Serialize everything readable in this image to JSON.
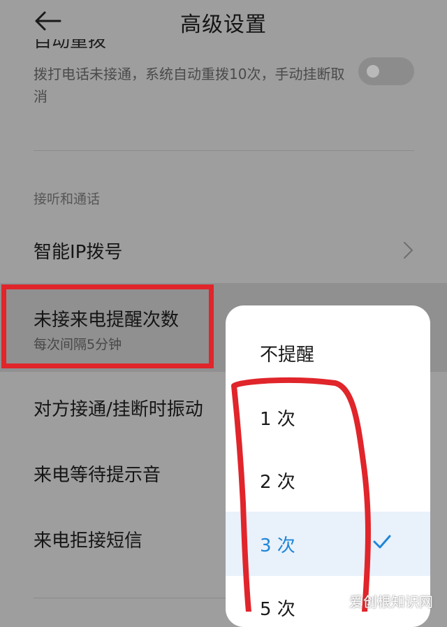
{
  "header": {
    "title": "高级设置",
    "back_icon": "arrow-left-icon"
  },
  "auto_redial": {
    "title": "自动重拨",
    "description": "拨打电话未接通，系统自动重拨10次，手动挂断取消",
    "toggle_on": false
  },
  "section": {
    "title": "接听和通话"
  },
  "rows": {
    "ip_dial": "智能IP拨号",
    "missed_reminder": "未接来电提醒次数",
    "missed_reminder_sub": "每次间隔5分钟",
    "vibrate": "对方接通/挂断时振动",
    "waiting_tone": "来电等待提示音",
    "reject_sms": "来电拒接短信"
  },
  "popup": {
    "options": [
      "不提醒",
      "1 次",
      "2 次",
      "3 次",
      "5 次"
    ],
    "selected": "3 次"
  },
  "colors": {
    "accent": "#1f86d8",
    "annotation": "#e0252b"
  },
  "watermark": "爱创根知识网"
}
